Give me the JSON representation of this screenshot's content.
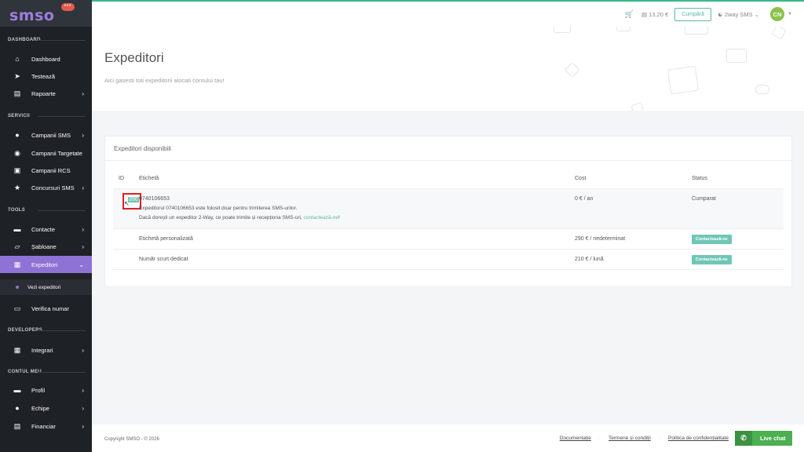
{
  "brand": {
    "logo": "smso",
    "bubble": "•••"
  },
  "topbar": {
    "cart_icon": "cart-icon",
    "balance": "13,20 €",
    "buy_label": "Cumpără",
    "twoway_label": "2way SMS",
    "avatar_initials": "CN"
  },
  "sidebar": {
    "sections": {
      "dashboard": "DASHBOARD",
      "servicii": "SERVICII",
      "tools": "TOOLS",
      "developers": "DEVELOPERS",
      "contul_meu": "CONTUL MEU"
    },
    "items": [
      {
        "label": "Dashboard",
        "icon": "home-icon"
      },
      {
        "label": "Testează",
        "icon": "paper-plane-icon"
      },
      {
        "label": "Rapoarte",
        "icon": "bar-chart-icon"
      },
      {
        "label": "Campanii SMS",
        "icon": "comment-icon"
      },
      {
        "label": "Campanii Targetate",
        "icon": "map-marker-icon"
      },
      {
        "label": "Campanii RCS",
        "icon": "image-icon"
      },
      {
        "label": "Concursuri SMS",
        "icon": "trophy-icon"
      },
      {
        "label": "Contacte",
        "icon": "contact-card-icon"
      },
      {
        "label": "Șabloane",
        "icon": "folder-open-icon"
      },
      {
        "label": "Expeditori",
        "icon": "sender-icon"
      },
      {
        "label": "Vezi expeditori",
        "icon": "dot-icon"
      },
      {
        "label": "Verifica numar",
        "icon": "laptop-icon"
      },
      {
        "label": "Integrari",
        "icon": "integration-icon"
      },
      {
        "label": "Profil",
        "icon": "id-card-icon"
      },
      {
        "label": "Echipe",
        "icon": "users-icon"
      },
      {
        "label": "Financiar",
        "icon": "credit-card-icon"
      }
    ]
  },
  "page": {
    "title": "Expeditori",
    "subtitle": "Aici gasesti toti expeditorii alocati contului tau!"
  },
  "card": {
    "title": "Expeditori disponibili",
    "headers": {
      "id": "ID",
      "label": "Etichetă",
      "cost": "Cost",
      "status": "Status"
    },
    "rows": [
      {
        "id": "390",
        "label": "0740106653",
        "desc1": "Expeditorul 0740106653 este folosit doar pentru trimiterea SMS-urilor.",
        "desc2": "Dacă dorești un expeditor 2-Way, ce poate trimite și recepționa SMS-uri, ",
        "desc_link": "contactează-ne",
        "desc_end": "!",
        "cost": "0 € / an",
        "status": "Cumparat"
      },
      {
        "label": "Etichetă personalizată",
        "cost": "290 € / nedeterminat",
        "status_badge": "Contactează-ne"
      },
      {
        "label": "Număr scurt dedicat",
        "cost": "210 € / lună",
        "status_badge": "Contactează-ne"
      }
    ]
  },
  "footer": {
    "copyright": "Copyright SMSO - © 2026",
    "links": [
      "Documentație",
      "Termene și condiții",
      "Politica de confidențialitate"
    ],
    "live_chat": "Live chat"
  },
  "colors": {
    "accent": "#8e72d6",
    "green": "#38b98a",
    "teal": "#6fc7b6",
    "chat": "#4caf50"
  }
}
